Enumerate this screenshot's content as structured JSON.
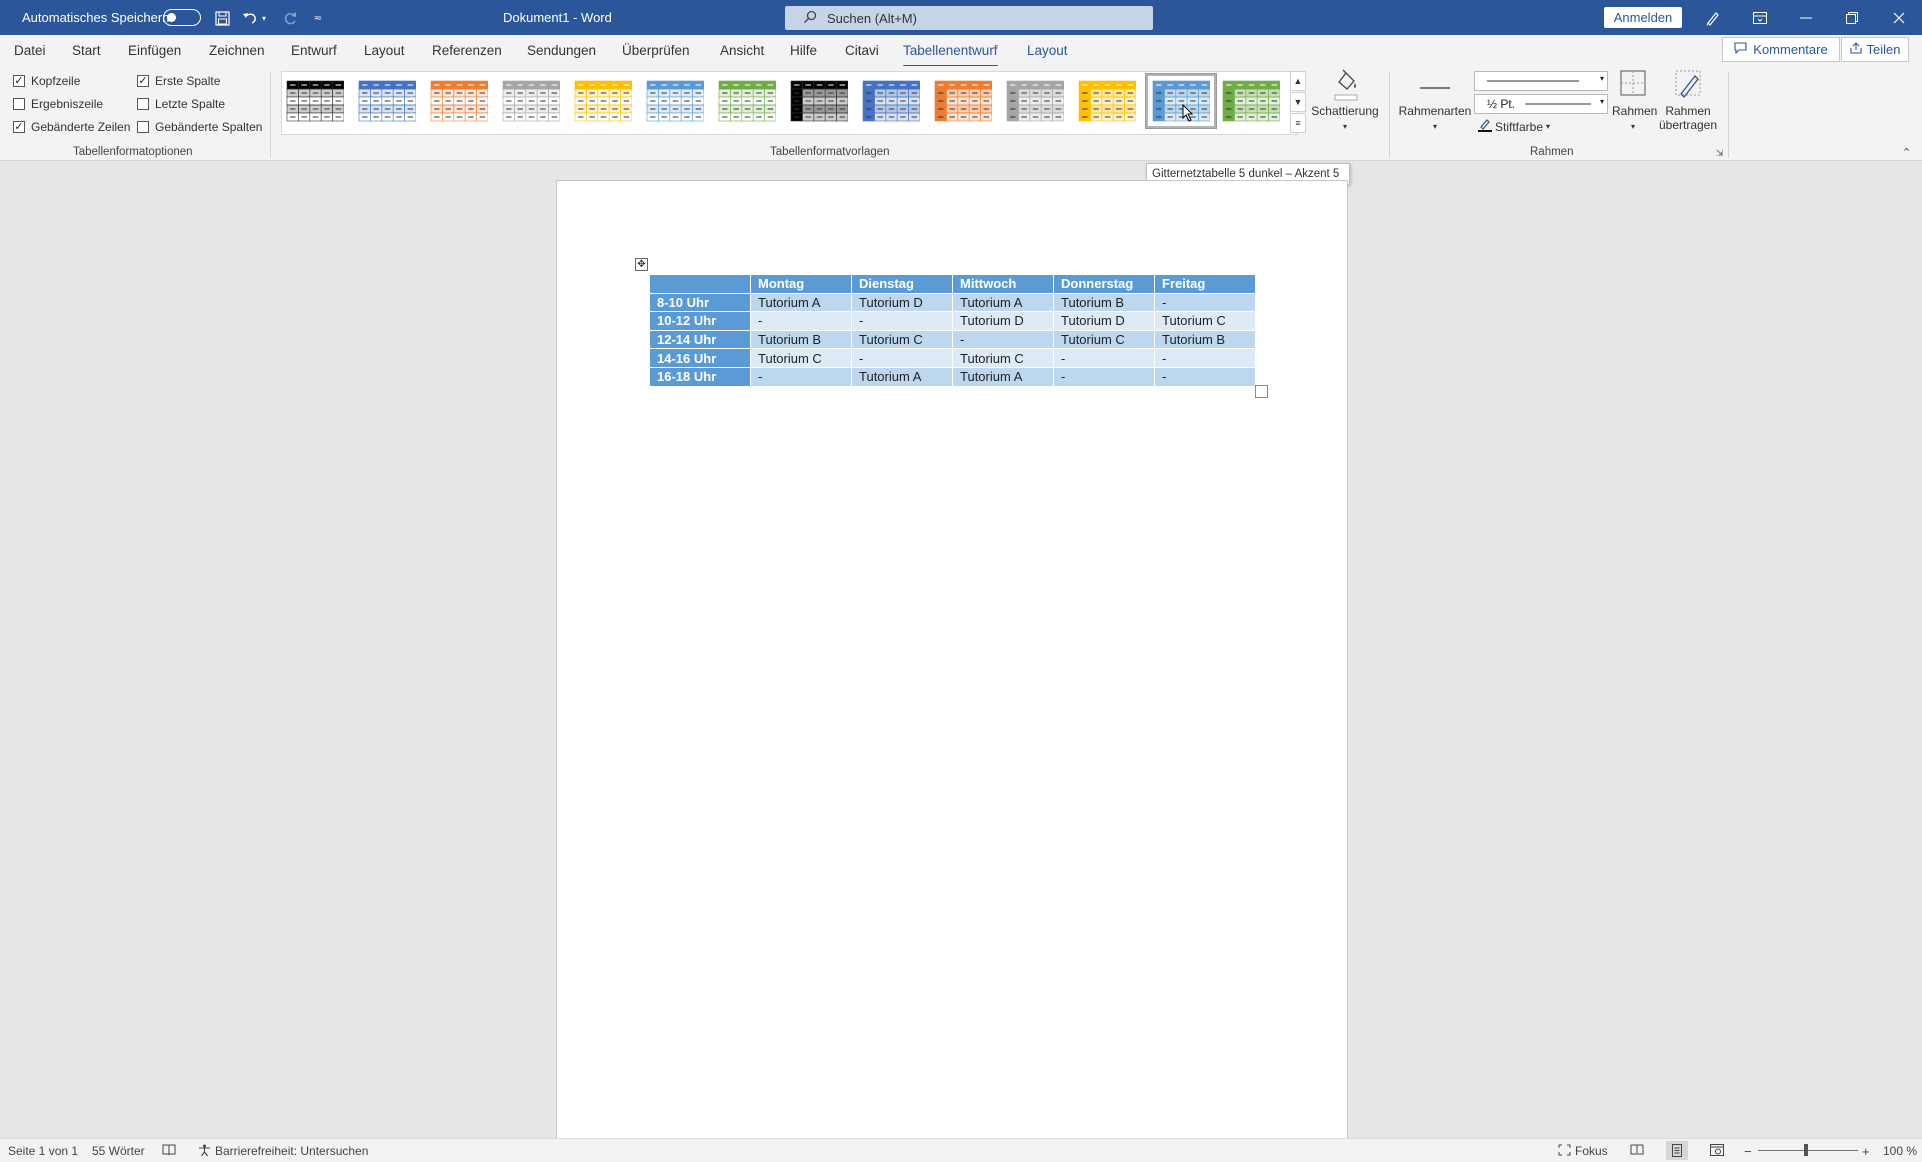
{
  "titlebar": {
    "autosave_label": "Automatisches Speichern",
    "doc_title": "Dokument1  -  Word",
    "search_placeholder": "Suchen (Alt+M)",
    "signin_label": "Anmelden"
  },
  "tabs": [
    "Datei",
    "Start",
    "Einfügen",
    "Zeichnen",
    "Entwurf",
    "Layout",
    "Referenzen",
    "Sendungen",
    "Überprüfen",
    "Ansicht",
    "Hilfe",
    "Citavi",
    "Tabellenentwurf",
    "Layout"
  ],
  "active_tab": "Tabellenentwurf",
  "comments_label": "Kommentare",
  "share_label": "Teilen",
  "ribbon": {
    "options": {
      "kopfzeile": {
        "label": "Kopfzeile",
        "checked": true
      },
      "ergebniszeile": {
        "label": "Ergebniszeile",
        "checked": false
      },
      "gebaenderte_zeilen": {
        "label": "Gebänderte Zeilen",
        "checked": true
      },
      "erste_spalte": {
        "label": "Erste Spalte",
        "checked": true
      },
      "letzte_spalte": {
        "label": "Letzte Spalte",
        "checked": false
      },
      "gebaenderte_spalten": {
        "label": "Gebänderte Spalten",
        "checked": false
      },
      "group_label": "Tabellenformatoptionen"
    },
    "styles_group_label": "Tabellenformatvorlagen",
    "style_colors": [
      "#000000",
      "#4472c4",
      "#ed7d31",
      "#a5a5a5",
      "#ffc000",
      "#5b9bd5",
      "#70ad47",
      "#000000",
      "#4472c4",
      "#ed7d31",
      "#a5a5a5",
      "#ffc000",
      "#5b9bd5",
      "#70ad47"
    ],
    "shading_label": "Schattierung",
    "border_styles_label": "Rahmenarten",
    "pen_weight": "½ Pt.",
    "pen_color_label": "Stiftfarbe",
    "borders_label": "Rahmen",
    "border_painter_label_1": "Rahmen",
    "border_painter_label_2": "übertragen",
    "borders_group_label": "Rahmen"
  },
  "tooltip": "Gitternetztabelle 5 dunkel  – Akzent 5",
  "table": {
    "headers": [
      "",
      "Montag",
      "Dienstag",
      "Mittwoch",
      "Donnerstag",
      "Freitag"
    ],
    "rows": [
      [
        "8-10 Uhr",
        "Tutorium A",
        "Tutorium D",
        "Tutorium A",
        "Tutorium B",
        "-"
      ],
      [
        "10-12 Uhr",
        "-",
        "-",
        "Tutorium D",
        "Tutorium D",
        "Tutorium C"
      ],
      [
        "12-14 Uhr",
        "Tutorium B",
        "Tutorium C",
        "-",
        "Tutorium C",
        "Tutorium B"
      ],
      [
        "14-16 Uhr",
        "Tutorium C",
        "-",
        "Tutorium C",
        "-",
        "-"
      ],
      [
        "16-18 Uhr",
        "-",
        "Tutorium A",
        "Tutorium A",
        "-",
        "-"
      ]
    ]
  },
  "status": {
    "page": "Seite 1 von 1",
    "words": "55 Wörter",
    "accessibility": "Barrierefreiheit: Untersuchen",
    "focus": "Fokus",
    "zoom": "100 %"
  }
}
